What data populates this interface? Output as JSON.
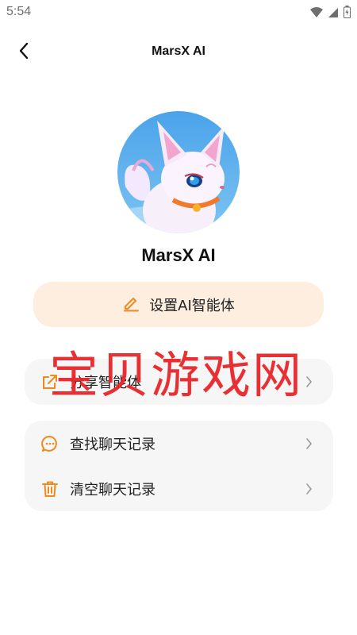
{
  "status_bar": {
    "time": "5:54",
    "icons": [
      "wifi-icon",
      "signal-icon",
      "battery-icon"
    ]
  },
  "header": {
    "title": "MarsX AI",
    "back_icon": "chevron-left-icon"
  },
  "profile": {
    "name": "MarsX AI",
    "avatar": "fox-character-avatar"
  },
  "configure_button": {
    "label": "设置AI智能体",
    "icon": "pencil-icon"
  },
  "menu": {
    "share": {
      "label": "分享智能体",
      "icon": "share-icon"
    },
    "find_history": {
      "label": "查找聊天记录",
      "icon": "chat-bubble-icon"
    },
    "clear_history": {
      "label": "清空聊天记录",
      "icon": "trash-icon"
    }
  },
  "watermark": {
    "text": "宝贝游戏网"
  },
  "colors": {
    "accent": "#f08a1c",
    "button_bg": "#fdeee0",
    "card_bg": "#f6f6f6",
    "watermark": "#e8262a"
  }
}
